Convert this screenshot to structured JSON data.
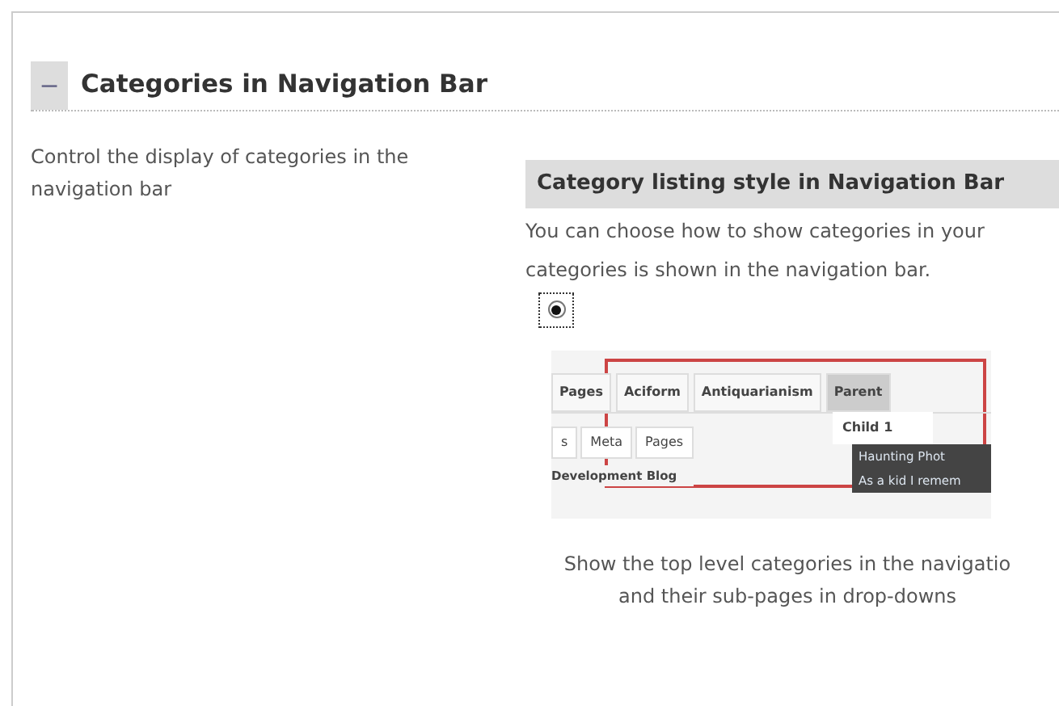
{
  "section": {
    "toggle": "−",
    "title": "Categories in Navigation Bar"
  },
  "description": "Control the display of categories in the navigation bar",
  "option_group": {
    "heading": "Category listing style in Navigation Bar",
    "intro_lines": [
      "You can choose how to show categories in your",
      "categories is shown in the navigation bar."
    ],
    "option": {
      "selected": true,
      "preview": {
        "top_tabs": [
          {
            "label": "Pages",
            "selected": false
          },
          {
            "label": "Aciform",
            "selected": false
          },
          {
            "label": "Antiquarianism",
            "selected": false
          },
          {
            "label": "Parent",
            "selected": true
          }
        ],
        "dropdown_header": "Child 1",
        "dropdown_items": [
          "Haunting Phot",
          "As a kid I remem"
        ],
        "side_tabs": [
          "s",
          "Meta",
          "Pages"
        ],
        "side_link": "Development Blog"
      },
      "caption_lines": [
        "Show the top level categories in the navigatio",
        "and their sub-pages in drop-downs"
      ]
    }
  }
}
